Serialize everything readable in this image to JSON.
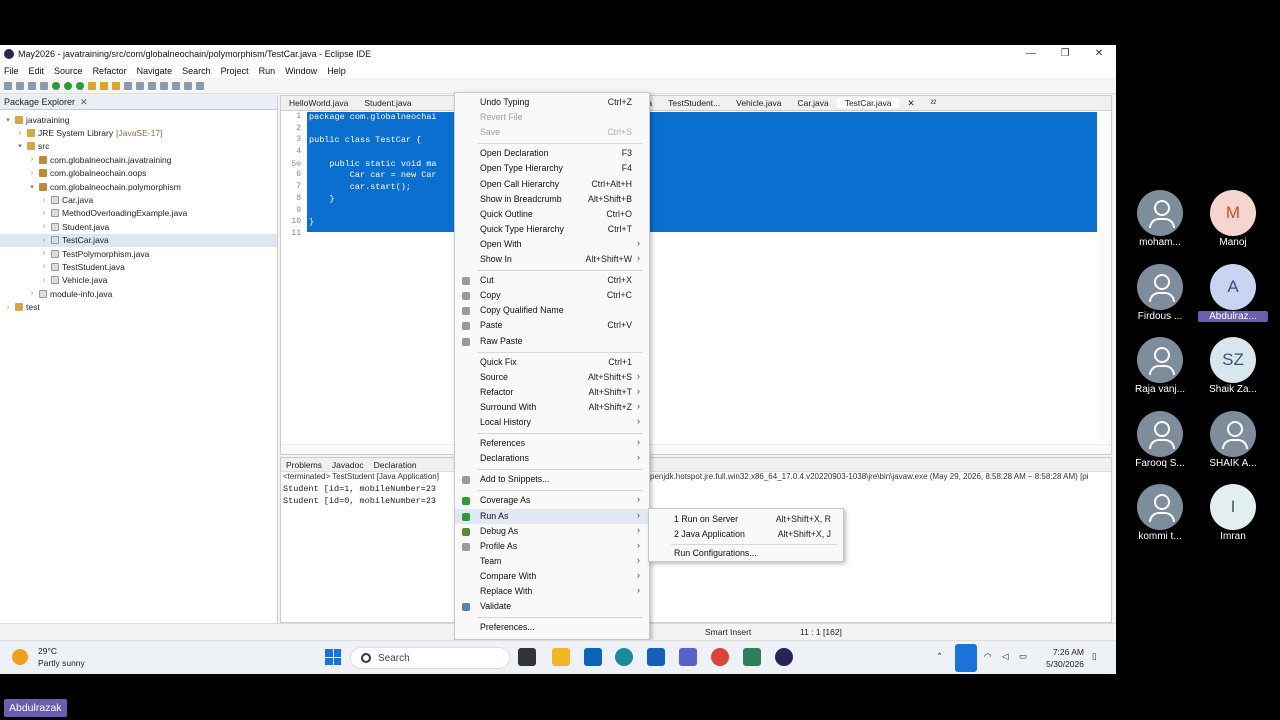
{
  "window": {
    "title": "May2026 - javatraining/src/com/globalneochain/polymorphism/TestCar.java - Eclipse IDE",
    "controls": [
      "—",
      "❐",
      "✕"
    ]
  },
  "menubar": [
    "File",
    "Edit",
    "Source",
    "Refactor",
    "Navigate",
    "Search",
    "Project",
    "Run",
    "Window",
    "Help"
  ],
  "package_explorer": {
    "title": "Package Explorer",
    "tree": [
      {
        "label": "javatraining",
        "arrow": "▾",
        "indent": 0,
        "icon": "project"
      },
      {
        "label": "JRE System Library",
        "suffix": "[JavaSE-17]",
        "arrow": "›",
        "indent": 1,
        "icon": "library"
      },
      {
        "label": "src",
        "arrow": "▾",
        "indent": 1,
        "icon": "folder"
      },
      {
        "label": "com.globalneochain.javatraining",
        "arrow": "›",
        "indent": 2,
        "icon": "package"
      },
      {
        "label": "com.globalneochain.oops",
        "arrow": "›",
        "indent": 2,
        "icon": "package"
      },
      {
        "label": "com.globalneochain.polymorphism",
        "arrow": "▾",
        "indent": 2,
        "icon": "package"
      },
      {
        "label": "Car.java",
        "arrow": "›",
        "indent": 3,
        "icon": "java"
      },
      {
        "label": "MethodOverloadingExample.java",
        "arrow": "›",
        "indent": 3,
        "icon": "java"
      },
      {
        "label": "Student.java",
        "arrow": "›",
        "indent": 3,
        "icon": "java"
      },
      {
        "label": "TestCar.java",
        "arrow": "›",
        "indent": 3,
        "icon": "java",
        "selected": true
      },
      {
        "label": "TestPolymorphism.java",
        "arrow": "›",
        "indent": 3,
        "icon": "java"
      },
      {
        "label": "TestStudent.java",
        "arrow": "›",
        "indent": 3,
        "icon": "java"
      },
      {
        "label": "Vehicle.java",
        "arrow": "›",
        "indent": 3,
        "icon": "java"
      },
      {
        "label": "module-info.java",
        "arrow": "›",
        "indent": 2,
        "icon": "java"
      },
      {
        "label": "test",
        "arrow": "›",
        "indent": 0,
        "icon": "project"
      }
    ]
  },
  "editor": {
    "tabs_left": [
      "HelloWorld.java",
      "Student.java"
    ],
    "tabs_right": [
      "dent.java",
      "TestStudent...",
      "Vehicle.java",
      "Car.java",
      "TestCar.java"
    ],
    "active_tab": "TestCar.java",
    "overflow": "²²",
    "line_numbers": [
      "1",
      "2",
      "3",
      "4",
      "5⊖",
      "6",
      "7",
      "8",
      "9",
      "10",
      "11"
    ],
    "code": [
      "package com.globalneochai",
      "",
      "public class TestCar {",
      "",
      "    public static void ma",
      "        Car car = new Car",
      "        car.start();",
      "    }",
      "",
      "}",
      ""
    ]
  },
  "console": {
    "tabs": [
      "Problems",
      "Javadoc",
      "Declaration"
    ],
    "header": "<terminated> TestStudent [Java Application]",
    "header_right": "penjdk.hotspot.jre.full.win32.x86_64_17.0.4.v20220903-1038\\jre\\bin\\javaw.exe  (May 29, 2026, 8:58:28 AM – 8:58:28 AM) [pi",
    "lines": [
      "Student [id=1, mobileNumber=23",
      "Student [id=0, mobileNumber=23"
    ]
  },
  "statusbar": {
    "mode": "Smart Insert",
    "position": "11 : 1 [162]"
  },
  "context_menu": [
    {
      "label": "Undo Typing",
      "accel": "Ctrl+Z"
    },
    {
      "label": "Revert File",
      "disabled": true
    },
    {
      "label": "Save",
      "accel": "Ctrl+S",
      "disabled": true
    },
    {
      "sep": true
    },
    {
      "label": "Open Declaration",
      "accel": "F3"
    },
    {
      "label": "Open Type Hierarchy",
      "accel": "F4"
    },
    {
      "label": "Open Call Hierarchy",
      "accel": "Ctrl+Alt+H"
    },
    {
      "label": "Show in Breadcrumb",
      "accel": "Alt+Shift+B"
    },
    {
      "label": "Quick Outline",
      "accel": "Ctrl+O"
    },
    {
      "label": "Quick Type Hierarchy",
      "accel": "Ctrl+T"
    },
    {
      "label": "Open With",
      "submenu": true
    },
    {
      "label": "Show In",
      "accel": "Alt+Shift+W",
      "submenu": true
    },
    {
      "sep": true
    },
    {
      "label": "Cut",
      "accel": "Ctrl+X",
      "icon": "cut"
    },
    {
      "label": "Copy",
      "accel": "Ctrl+C",
      "icon": "copy"
    },
    {
      "label": "Copy Qualified Name",
      "icon": "copy"
    },
    {
      "label": "Paste",
      "accel": "Ctrl+V",
      "icon": "paste"
    },
    {
      "label": "Raw Paste",
      "icon": "paste"
    },
    {
      "sep": true
    },
    {
      "label": "Quick Fix",
      "accel": "Ctrl+1"
    },
    {
      "label": "Source",
      "accel": "Alt+Shift+S",
      "submenu": true
    },
    {
      "label": "Refactor",
      "accel": "Alt+Shift+T",
      "submenu": true
    },
    {
      "label": "Surround With",
      "accel": "Alt+Shift+Z",
      "submenu": true
    },
    {
      "label": "Local History",
      "submenu": true
    },
    {
      "sep": true
    },
    {
      "label": "References",
      "submenu": true
    },
    {
      "label": "Declarations",
      "submenu": true
    },
    {
      "sep": true
    },
    {
      "label": "Add to Snippets...",
      "icon": "snippet"
    },
    {
      "sep": true
    },
    {
      "label": "Coverage As",
      "submenu": true,
      "icon": "coverage"
    },
    {
      "label": "Run As",
      "submenu": true,
      "icon": "run",
      "highlight": true
    },
    {
      "label": "Debug As",
      "submenu": true,
      "icon": "debug"
    },
    {
      "label": "Profile As",
      "submenu": true,
      "icon": "profile"
    },
    {
      "label": "Team",
      "submenu": true
    },
    {
      "label": "Compare With",
      "submenu": true
    },
    {
      "label": "Replace With",
      "submenu": true
    },
    {
      "label": "Validate",
      "icon": "check"
    },
    {
      "sep": true
    },
    {
      "label": "Preferences..."
    }
  ],
  "run_as_submenu": [
    {
      "label": "1 Run on Server",
      "accel": "Alt+Shift+X, R"
    },
    {
      "label": "2 Java Application",
      "accel": "Alt+Shift+X, J"
    },
    {
      "sep": true
    },
    {
      "label": "Run Configurations..."
    }
  ],
  "taskbar": {
    "temperature": "29°C",
    "condition": "Partly sunny",
    "search": "Search",
    "time": "7:26 AM",
    "date": "5/30/2026"
  },
  "participants": [
    {
      "name": "moham...",
      "initials": "",
      "color": "#7d8d9c"
    },
    {
      "name": "Manoj",
      "initials": "M",
      "color": "#f4d6cf",
      "text_color": "#d04a2e"
    },
    {
      "name": "Firdous ...",
      "initials": "",
      "color": "#7d8d9c"
    },
    {
      "name": "Abdulraz...",
      "initials": "A",
      "color": "#c9d4f0",
      "text_color": "#3a4a8a",
      "highlight": true
    },
    {
      "name": "Raja vanj...",
      "initials": "",
      "color": "#7d8d9c"
    },
    {
      "name": "Shaik Za...",
      "initials": "SZ",
      "color": "#d8e6ee",
      "text_color": "#3a5a6a"
    },
    {
      "name": "Farooq S...",
      "initials": "",
      "color": "#7d8d9c"
    },
    {
      "name": "SHAIK A...",
      "initials": "",
      "color": "#7d8d9c"
    },
    {
      "name": "kommi t...",
      "initials": "",
      "color": "#7d8d9c"
    },
    {
      "name": "Imran",
      "initials": "I",
      "color": "#e2eef0",
      "text_color": "#3a6070"
    }
  ],
  "speaker": "Abdulrazak"
}
